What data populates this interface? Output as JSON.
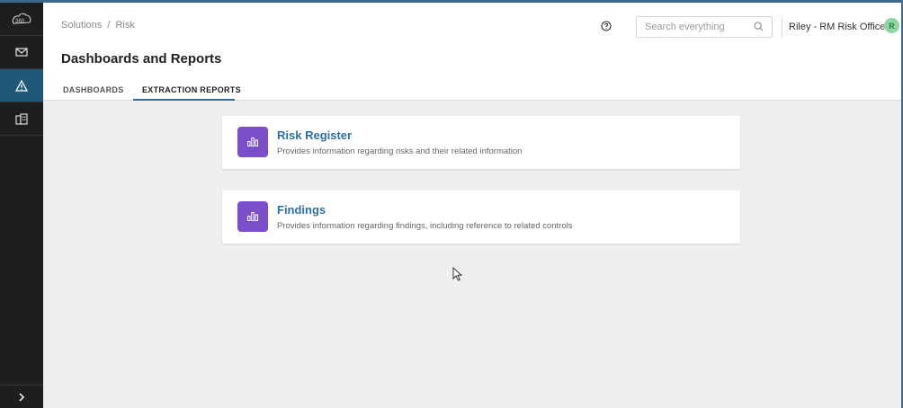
{
  "sidebar": {
    "logo": "360",
    "items": [
      {
        "icon": "mail-icon"
      },
      {
        "icon": "warning-triangle-icon",
        "active": true
      },
      {
        "icon": "building-icon"
      }
    ],
    "expand_icon": "chevron-right-icon"
  },
  "header": {
    "breadcrumb": {
      "root": "Solutions",
      "separator": "/",
      "current": "Risk"
    },
    "help_icon": "help-circle-icon",
    "search": {
      "placeholder": "Search everything",
      "value": ""
    },
    "user": {
      "name": "Riley - RM Risk Officer",
      "initial": "R",
      "avatar_color": "#8fd6a4"
    }
  },
  "page": {
    "title": "Dashboards and Reports",
    "tabs": [
      {
        "label": "DASHBOARDS",
        "active": false
      },
      {
        "label": "EXTRACTION REPORTS",
        "active": true
      }
    ]
  },
  "reports": [
    {
      "title": "Risk Register",
      "description": "Provides information regarding risks and their related information",
      "icon": "bar-chart-icon"
    },
    {
      "title": "Findings",
      "description": "Provides information regarding findings, including reference to related controls",
      "icon": "bar-chart-icon"
    }
  ],
  "colors": {
    "accent": "#2a6fa0",
    "sidebar_bg": "#1e1e1e",
    "sidebar_active": "#1f5878",
    "card_icon_bg": "#7b4fc9"
  }
}
